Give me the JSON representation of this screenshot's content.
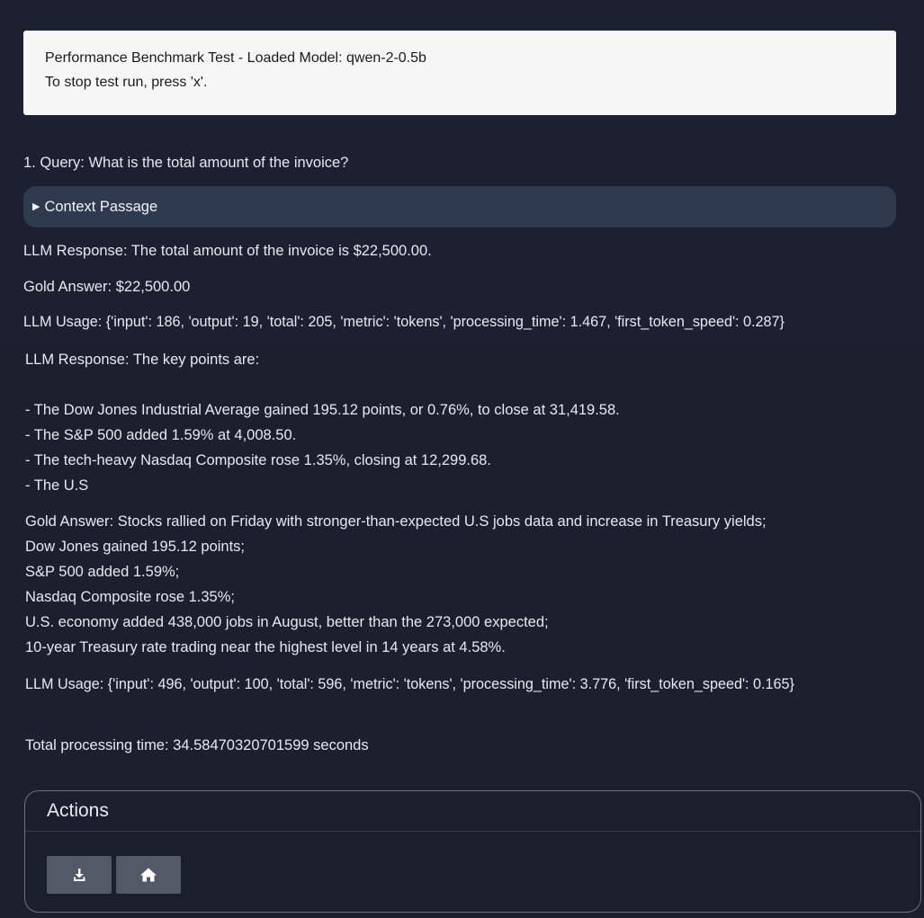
{
  "header": {
    "line1": "Performance Benchmark Test - Loaded Model: qwen-2-0.5b",
    "line2": "To stop test run, press 'x'."
  },
  "query1": {
    "query": "1. Query: What is the total amount of the invoice?",
    "context_label": "Context Passage",
    "llm_response": "LLM Response: The total amount of the invoice is $22,500.00.",
    "gold_answer": "Gold Answer: $22,500.00",
    "llm_usage": "LLM Usage: {'input': 186, 'output': 19, 'total': 205, 'metric': 'tokens', 'processing_time': 1.467, 'first_token_speed': 0.287}"
  },
  "query2": {
    "llm_response_title": "LLM Response: The key points are:",
    "llm_response_points": [
      "- The Dow Jones Industrial Average gained 195.12 points, or 0.76%, to close at 31,419.58.",
      "- The S&P 500 added 1.59% at 4,008.50.",
      "- The tech-heavy Nasdaq Composite rose 1.35%, closing at 12,299.68.",
      "- The U.S"
    ],
    "gold_answer_lines": [
      "Gold Answer: Stocks rallied on Friday with stronger-than-expected U.S jobs data and increase in Treasury yields;",
      "Dow Jones gained 195.12 points;",
      "S&P 500 added 1.59%;",
      "Nasdaq Composite rose 1.35%;",
      "U.S. economy added 438,000 jobs in August, better than the 273,000 expected;",
      "10-year Treasury rate trading near the highest level in 14 years at 4.58%."
    ],
    "llm_usage": "LLM Usage: {'input': 496, 'output': 100, 'total': 596, 'metric': 'tokens', 'processing_time': 3.776, 'first_token_speed': 0.165}"
  },
  "total_time": "Total processing time: 34.58470320701599 seconds",
  "actions": {
    "title": "Actions",
    "buttons": [
      {
        "icon": "download-icon"
      },
      {
        "icon": "home-icon"
      }
    ]
  }
}
